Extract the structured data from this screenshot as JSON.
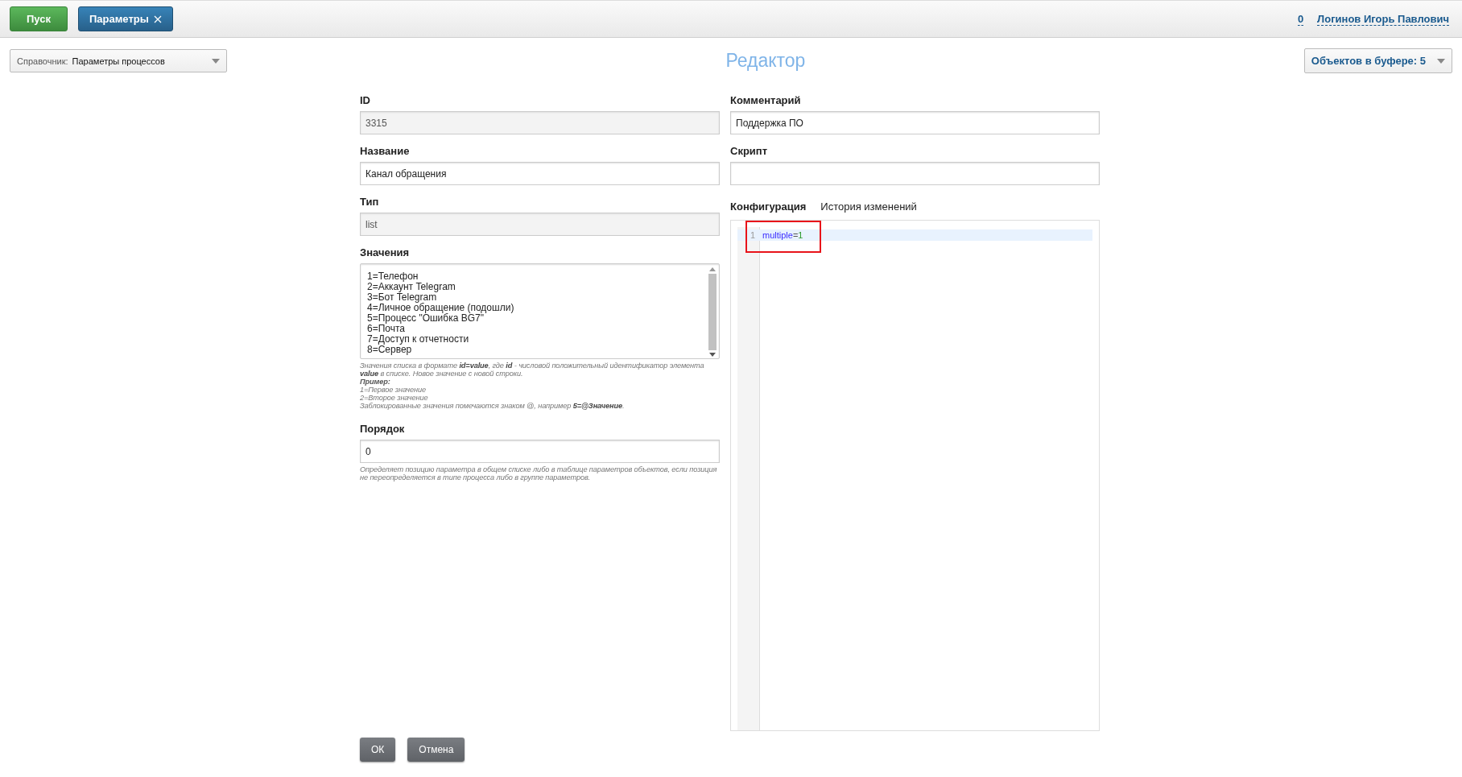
{
  "top_bar": {
    "buttons": [
      {
        "label": "Пуск",
        "kind": "start"
      },
      {
        "label": "Параметры",
        "kind": "tab",
        "closable": true
      }
    ],
    "counter": "0",
    "user": "Логинов Игорь Павлович"
  },
  "directory_select": {
    "label": "Справочник:",
    "value": "Параметры процессов"
  },
  "title": "Редактор",
  "buffer_button": {
    "label": "Объектов в буфере: 5"
  },
  "left_fields": [
    {
      "label": "ID",
      "kind": "input",
      "value": "3315",
      "disabled": true
    },
    {
      "label": "Название",
      "kind": "input",
      "value": "Канал обращения",
      "disabled": false
    },
    {
      "label": "Тип",
      "kind": "input",
      "value": "list",
      "disabled": true
    },
    {
      "label": "Значения",
      "kind": "textarea",
      "lines": [
        "1=Телефон",
        "2=Аккаунт Telegram",
        "3=Бот Telegram",
        "4=Личное обращение (подошли)",
        "5=Процесс \"Ошибка BG7\"",
        "6=Почта",
        "7=Доступ к отчетности",
        "8=Сервер"
      ],
      "hint": [
        {
          "text": "Значения списка в формате **id=value**, где **id** - числовой положительный идентификатор элемента **value** в списке. Новое значение с новой строки.",
          "kind": "normal"
        },
        {
          "text": "Пример:",
          "kind": "bold"
        },
        {
          "text": "1=Первое значение",
          "kind": "normal"
        },
        {
          "text": "2=Второе значение",
          "kind": "normal"
        },
        {
          "text": "Заблокированные значения помечаются знаком @, например **5=@Значение**.",
          "kind": "normal"
        }
      ]
    },
    {
      "label": "Порядок",
      "kind": "input",
      "value": "0",
      "disabled": false,
      "hint": [
        {
          "text": "Определяет позицию параметра в общем списке либо в таблице параметров объектов, если позиция не переопределяется в типе процесса либо в группе параметров.",
          "kind": "normal"
        }
      ]
    }
  ],
  "right_fields": [
    {
      "label": "Комментарий",
      "kind": "input",
      "value": "Поддержка ПО",
      "disabled": false
    },
    {
      "label": "Скрипт",
      "kind": "input",
      "disabled": false
    }
  ],
  "editor_tabs": [
    {
      "label": "Конфигурация",
      "selected": true
    },
    {
      "label": "История изменений",
      "selected": false
    }
  ],
  "editor": {
    "lines": [
      {
        "number": "1",
        "current": true,
        "tokens": [
          {
            "text": "multiple",
            "kind": "keyword"
          },
          {
            "text": "=",
            "kind": "operator"
          },
          {
            "text": "1",
            "kind": "number"
          }
        ]
      }
    ],
    "highlight_frame": true
  },
  "buttons": [
    {
      "label": "ОК"
    },
    {
      "label": "Отмена"
    }
  ]
}
